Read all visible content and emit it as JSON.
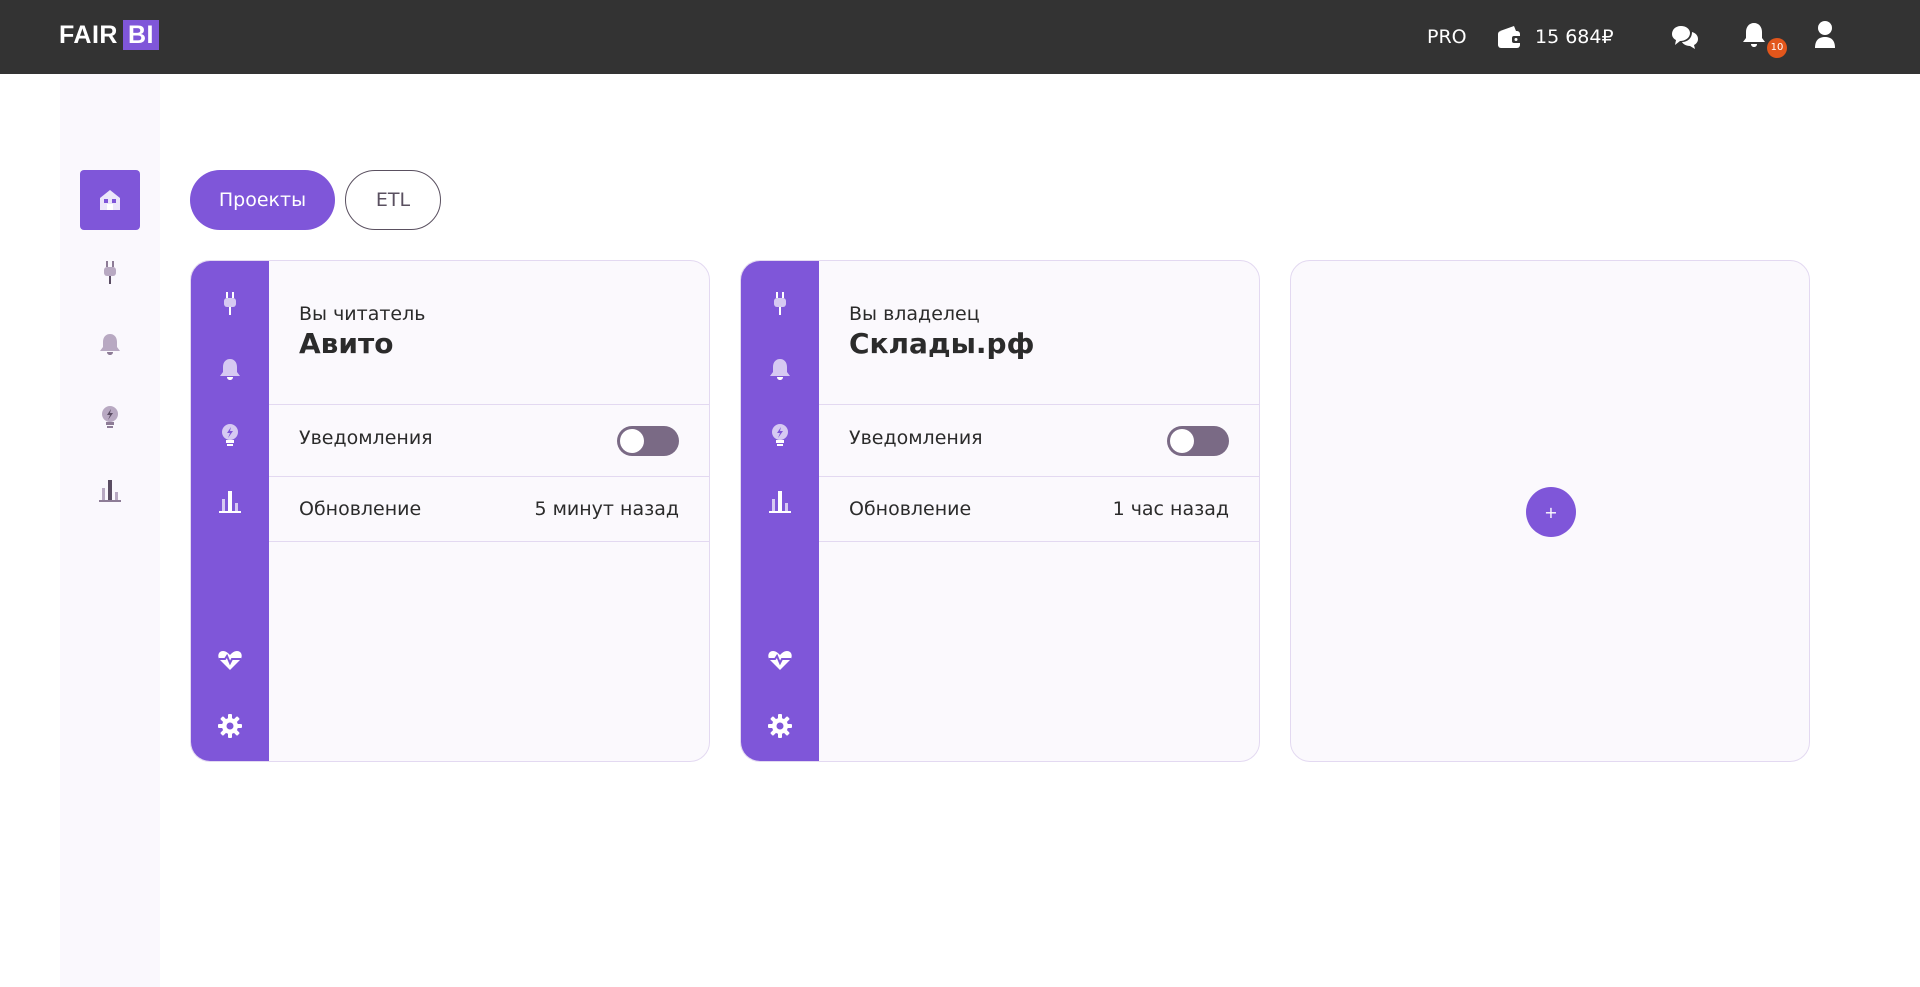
{
  "header": {
    "logo_text": "FAIR",
    "logo_badge": "BI",
    "plan": "PRO",
    "balance": "15 684₽",
    "notifications_count": "10",
    "icons": [
      "wallet-icon",
      "chat-icon",
      "bell-icon",
      "user-icon"
    ]
  },
  "sidebar": {
    "items": [
      {
        "icon": "home-icon",
        "active": true
      },
      {
        "icon": "plug-icon",
        "active": false
      },
      {
        "icon": "bell-icon",
        "active": false
      },
      {
        "icon": "bulb-icon",
        "active": false
      },
      {
        "icon": "chart-icon",
        "active": false
      }
    ]
  },
  "tabs": [
    {
      "label": "Проекты",
      "active": true
    },
    {
      "label": "ETL",
      "active": false
    }
  ],
  "projects": [
    {
      "role": "Вы читатель",
      "name": "Авито",
      "notifications_label": "Уведомления",
      "notifications_on": false,
      "update_label": "Обновление",
      "update_value": "5 минут назад"
    },
    {
      "role": "Вы владелец",
      "name": "Склады.рф",
      "notifications_label": "Уведомления",
      "notifications_on": false,
      "update_label": "Обновление",
      "update_value": "1 час назад"
    }
  ],
  "add_button": {
    "label": "+"
  },
  "colors": {
    "accent": "#7f56d9",
    "header_bg": "#333333",
    "badge": "#e2561b",
    "toggle_off": "#7a6a85"
  }
}
